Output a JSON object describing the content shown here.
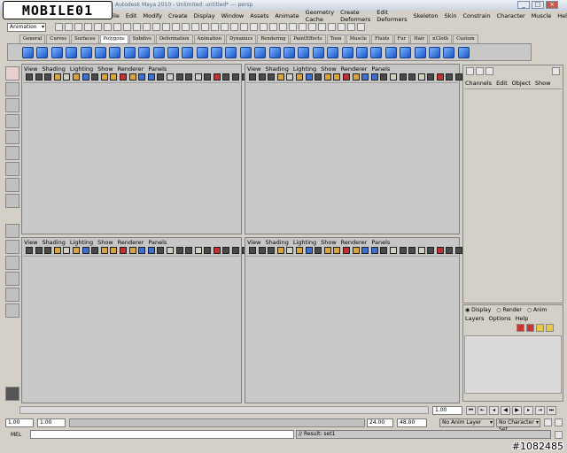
{
  "watermark": {
    "logo": "MOBILE01",
    "id_text": "#1082485"
  },
  "window": {
    "title": "Autodesk Maya 2010 - Unlimited: untitled* --- persp",
    "controls": [
      "_",
      "□",
      "×"
    ]
  },
  "menubar": [
    "File",
    "Edit",
    "Modify",
    "Create",
    "Display",
    "Window",
    "Assets",
    "Animate",
    "Geometry Cache",
    "Create Deformers",
    "Edit Deformers",
    "Skeleton",
    "Skin",
    "Constrain",
    "Character",
    "Muscle",
    "Help"
  ],
  "statusline": {
    "menuset": "Animation"
  },
  "shelf_tabs": [
    "General",
    "Curves",
    "Surfaces",
    "Polygons",
    "Subdivs",
    "Deformation",
    "Animation",
    "Dynamics",
    "Rendering",
    "PaintEffects",
    "Toon",
    "Muscle",
    "Fluids",
    "Fur",
    "Hair",
    "nCloth",
    "Custom"
  ],
  "active_shelf_tab": "Polygons",
  "viewport_menu": [
    "View",
    "Shading",
    "Lighting",
    "Show",
    "Renderer",
    "Panels"
  ],
  "channel_box": {
    "menu": [
      "Channels",
      "Edit",
      "Object",
      "Show"
    ]
  },
  "layer_editor": {
    "modes": [
      "Display",
      "Render",
      "Anim"
    ],
    "menu": [
      "Layers",
      "Options",
      "Help"
    ]
  },
  "time_slider": {
    "current_frame": "1.00"
  },
  "range_slider": {
    "start_time": "1.00",
    "playback_start": "1.00",
    "playback_end": "24.00",
    "end_time": "48.00",
    "anim_layer": "No Anim Layer",
    "character_set": "No Character Set"
  },
  "command_line": {
    "label": "MEL",
    "result": "// Result: set1"
  }
}
